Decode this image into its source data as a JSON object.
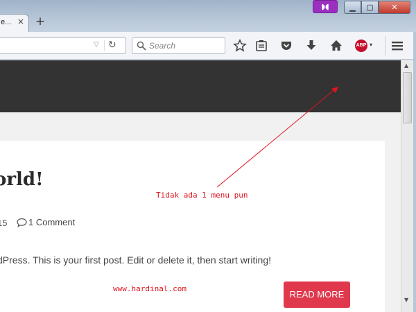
{
  "tab": {
    "title": "e...",
    "close": "×",
    "new_tab": "+"
  },
  "window": {
    "mask": "◗◖",
    "minimize": "▁",
    "maximize": "▢",
    "close": "✕"
  },
  "navbar": {
    "url_value": "",
    "search_placeholder": "Search",
    "reload": "↻",
    "dropmarker": "▽",
    "abp_label": "ABP",
    "abp_caret": "▾",
    "icons": [
      "bookmark-star-icon",
      "reading-list-icon",
      "pocket-icon",
      "downloads-icon",
      "home-icon",
      "abp-icon",
      "menu-icon"
    ]
  },
  "page": {
    "post_title": "orld!",
    "post_date_fragment": "15",
    "comments": "1 Comment",
    "excerpt": "dPress. This is your first post. Edit or delete it, then start writing!",
    "read_more": "READ MORE"
  },
  "scrollbar": {
    "up": "▲",
    "down": "▼"
  },
  "annotations": {
    "note": "Tidak ada 1 menu pun",
    "watermark": "www.hardinal.com",
    "color": "#e1141e"
  },
  "colors": {
    "header_bg": "#333333",
    "button_accent": "#e0394d",
    "abp_red": "#c70d2c",
    "private_mask": "#9a2fc0"
  }
}
